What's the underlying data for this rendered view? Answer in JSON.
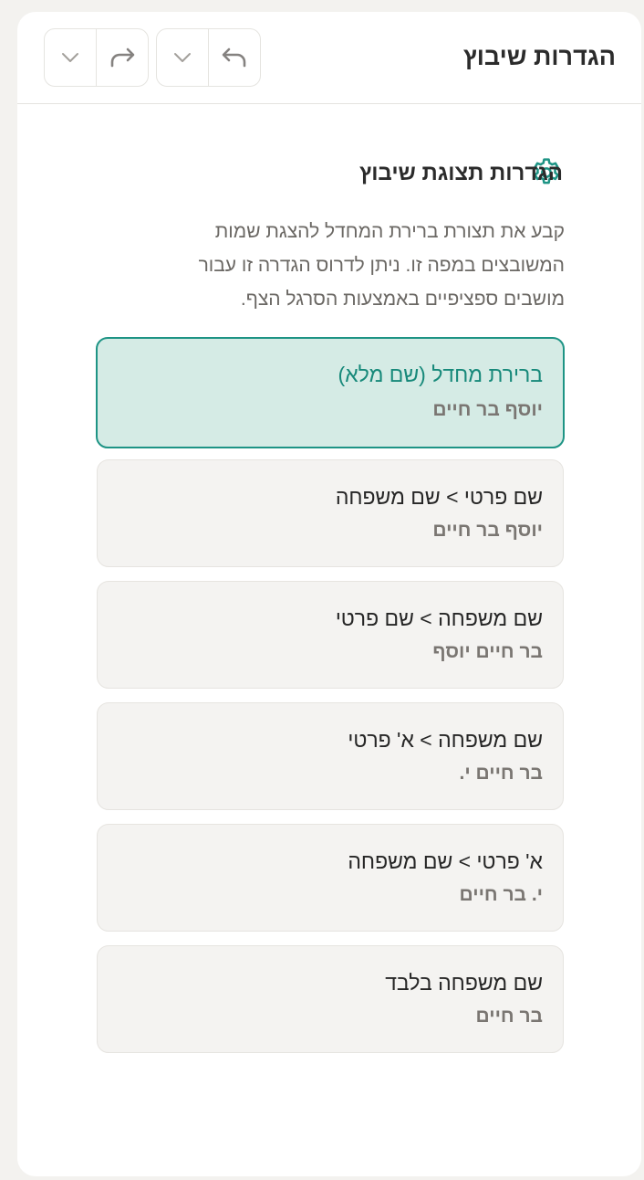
{
  "header": {
    "title": "הגדרות שיבוץ",
    "undo_icon": "undo-arrow-icon",
    "redo_icon": "redo-arrow-icon",
    "dropdown_icon": "chevron-down-icon"
  },
  "section": {
    "icon": "gear-icon",
    "title": "הגדרות תצוגת שיבוץ",
    "description": "קבע את תצורת ברירת המחדל להצגת שמות המשובצים במפה זו. ניתן לדרוס הגדרה זו עבור מושבים ספציפיים באמצעות הסרגל הצף."
  },
  "options": [
    {
      "label": "ברירת מחדל (שם מלא)",
      "example": "יוסף בר חיים",
      "selected": true
    },
    {
      "label": "שם פרטי > שם משפחה",
      "example": "יוסף בר חיים",
      "selected": false
    },
    {
      "label": "שם משפחה > שם פרטי",
      "example": "בר חיים יוסף",
      "selected": false
    },
    {
      "label": "שם משפחה > א' פרטי",
      "example": "בר חיים י.",
      "selected": false
    },
    {
      "label": "א' פרטי > שם משפחה",
      "example": "י. בר חיים",
      "selected": false
    },
    {
      "label": "שם משפחה בלבד",
      "example": "בר חיים",
      "selected": false
    }
  ],
  "colors": {
    "accent": "#1e9485",
    "selected_bg": "#d5ebe5",
    "option_bg": "#f4f3f1",
    "page_bg": "#f3f2ef"
  }
}
